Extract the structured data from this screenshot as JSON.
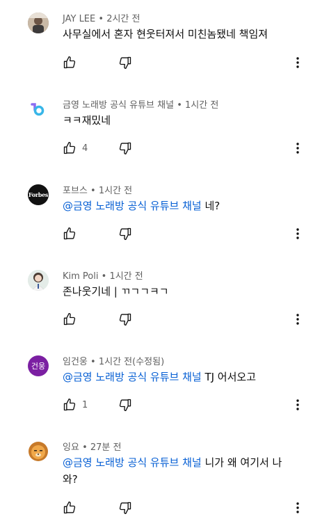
{
  "comments": [
    {
      "author": "JAY LEE",
      "time": "2시간 전",
      "text": "사무실에서 혼자 현웃터져서 미친놈됐네 책임져",
      "likes": "",
      "avatar_icon": "photo-avatar"
    },
    {
      "author": "금영 노래방 공식 유튜브 채널",
      "time": "1시간 전",
      "text": "ㅋㅋ재밌네",
      "likes": "4",
      "avatar_icon": "ky-logo-avatar"
    },
    {
      "author": "포브스",
      "time": "1시간 전",
      "mention": "@금영 노래방 공식 유튜브 채널",
      "text": " 네?",
      "likes": "",
      "avatar_text": "Forbes"
    },
    {
      "author": "Kim Poli",
      "time": "1시간 전",
      "text": "존나웃기네 | ㄲㄱㄱㅋㄱ",
      "likes": "",
      "avatar_icon": "photo-avatar"
    },
    {
      "author": "임건웅",
      "time": "1시간 전(수정됨)",
      "mention": "@금영 노래방 공식 유튜브 채널",
      "text": " TJ 어서오고",
      "likes": "1",
      "avatar_text": "건웅",
      "avatar_color": "#7b1fa2"
    },
    {
      "author": "잉요",
      "time": "27분 전",
      "mention": "@금영 노래방 공식 유튜브 채널",
      "text": " 니가 왜 여기서 나와?",
      "likes": "",
      "avatar_icon": "lion-character-avatar"
    }
  ],
  "separator": "•",
  "colors": {
    "mention": "#065fd4",
    "meta": "#606060",
    "text": "#0f0f0f"
  }
}
